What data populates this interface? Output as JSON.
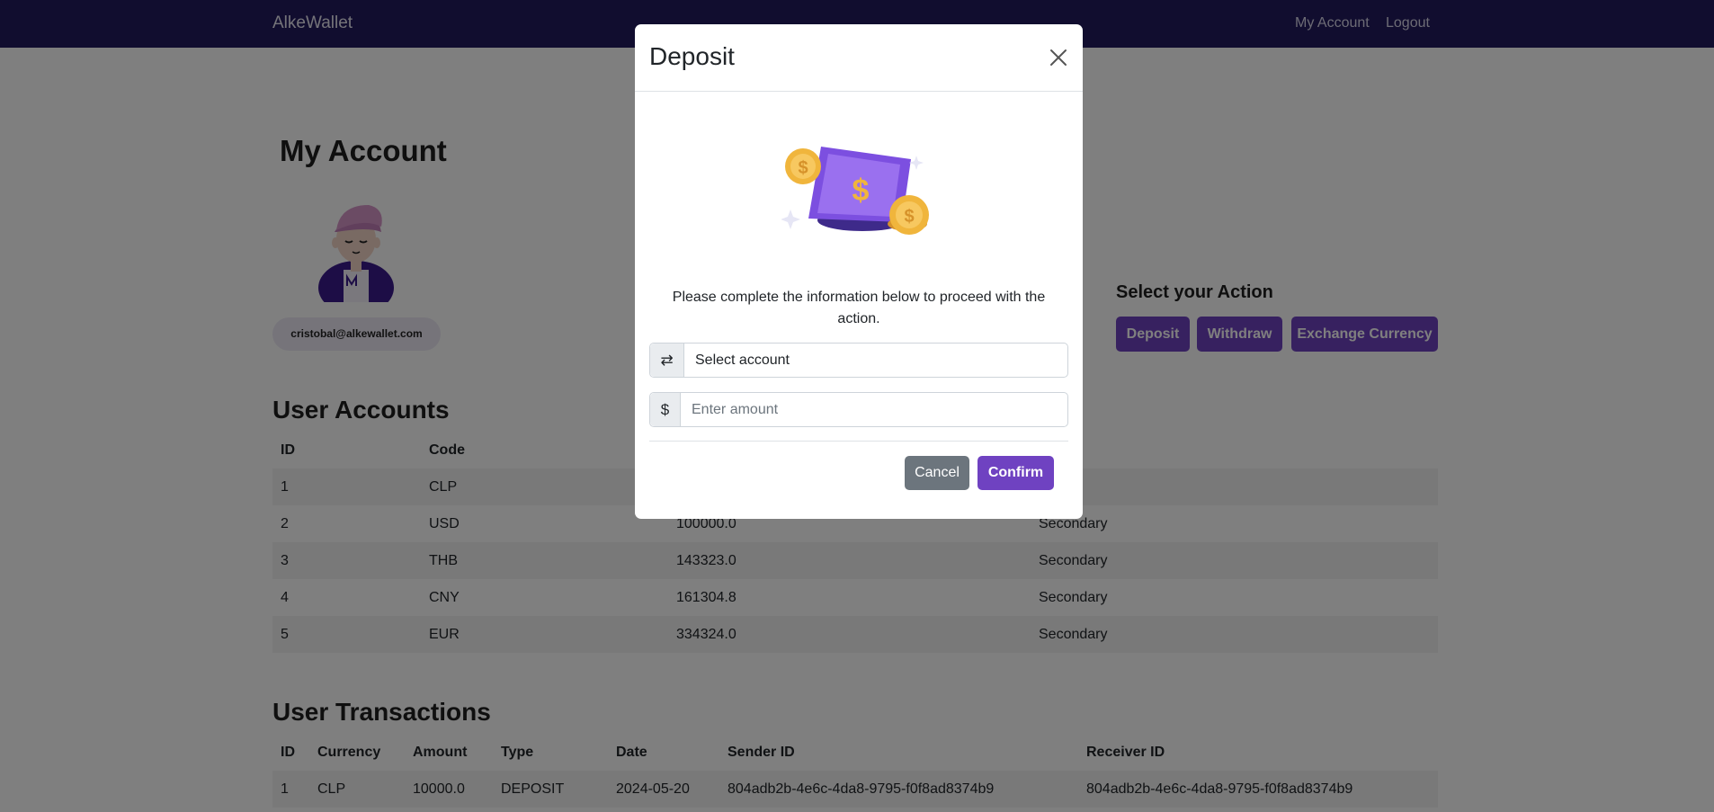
{
  "navbar": {
    "brand": "AlkeWallet",
    "links": [
      "My Account",
      "Logout"
    ]
  },
  "page": {
    "title": "My Account",
    "email": "cristobal@alkewallet.com"
  },
  "actions": {
    "heading": "Select your Action",
    "buttons": [
      "Deposit",
      "Withdraw",
      "Exchange Currency"
    ]
  },
  "accounts": {
    "title": "User Accounts",
    "columns": [
      "ID",
      "Code",
      "",
      ""
    ],
    "rows": [
      [
        "1",
        "CLP",
        "",
        ""
      ],
      [
        "2",
        "USD",
        "100000.0",
        "Secondary"
      ],
      [
        "3",
        "THB",
        "143323.0",
        "Secondary"
      ],
      [
        "4",
        "CNY",
        "161304.8",
        "Secondary"
      ],
      [
        "5",
        "EUR",
        "334324.0",
        "Secondary"
      ]
    ]
  },
  "transactions": {
    "title": "User Transactions",
    "columns": [
      "ID",
      "Currency",
      "Amount",
      "Type",
      "Date",
      "Sender ID",
      "Receiver ID"
    ],
    "rows": [
      [
        "1",
        "CLP",
        "10000.0",
        "DEPOSIT",
        "2024-05-20",
        "804adb2b-4e6c-4da8-9795-f0f8ad8374b9",
        "804adb2b-4e6c-4da8-9795-f0f8ad8374b9"
      ]
    ]
  },
  "modal": {
    "title": "Deposit",
    "description": "Please complete the information below to proceed with the action.",
    "select_addon": "⇄",
    "select_value": "Select account",
    "amount_addon": "$",
    "amount_placeholder": "Enter amount",
    "cancel_label": "Cancel",
    "confirm_label": "Confirm"
  },
  "colors": {
    "navbar": "#231b5e",
    "accent": "#6f42c1",
    "secondary": "#6c757d"
  },
  "icons": {
    "close": "close-icon",
    "transfer": "arrows-exchange-icon",
    "dollar": "dollar-sign-icon"
  }
}
